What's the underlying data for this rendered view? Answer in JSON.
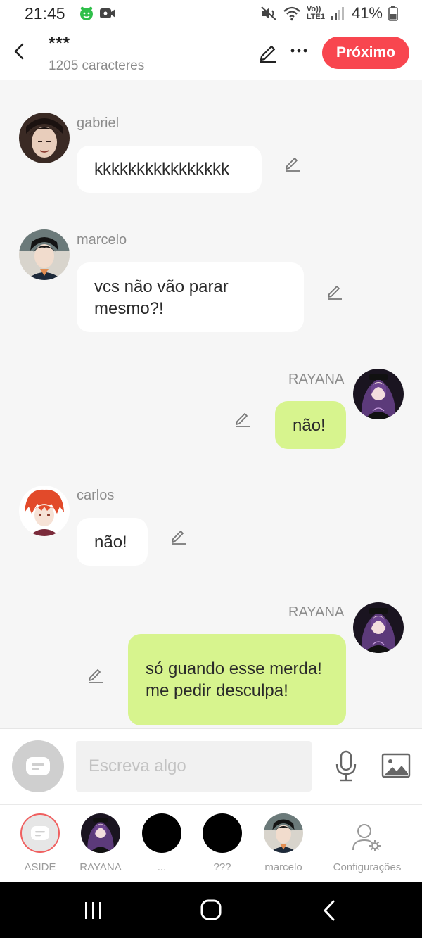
{
  "status": {
    "time": "21:45",
    "signal_label_top": "Vo))",
    "signal_label_bottom": "LTE1",
    "battery": "41%"
  },
  "header": {
    "title": "***",
    "subtitle": "1205 caracteres",
    "next_label": "Próximo"
  },
  "messages": [
    {
      "sender": "gabriel",
      "text": "kkkkkkkkkkkkkkkk",
      "side": "left"
    },
    {
      "sender": "marcelo",
      "text": "vcs não vão parar mesmo?!",
      "side": "left"
    },
    {
      "sender": "RAYANA",
      "text": "não!",
      "side": "right"
    },
    {
      "sender": "carlos",
      "text": "não!",
      "side": "left"
    },
    {
      "sender": "RAYANA",
      "text": "só guando esse merda! me pedir desculpa!",
      "side": "right"
    }
  ],
  "composer": {
    "placeholder": "Escreva algo"
  },
  "bottom_tabs": [
    {
      "label": "ASIDE"
    },
    {
      "label": "RAYANA"
    },
    {
      "label": "..."
    },
    {
      "label": "???"
    },
    {
      "label": "marcelo"
    },
    {
      "label": "Configurações"
    }
  ],
  "colors": {
    "accent": "#f8464f",
    "own_bubble": "#d7f48e",
    "other_bubble": "#ffffff",
    "background": "#f6f6f6"
  }
}
